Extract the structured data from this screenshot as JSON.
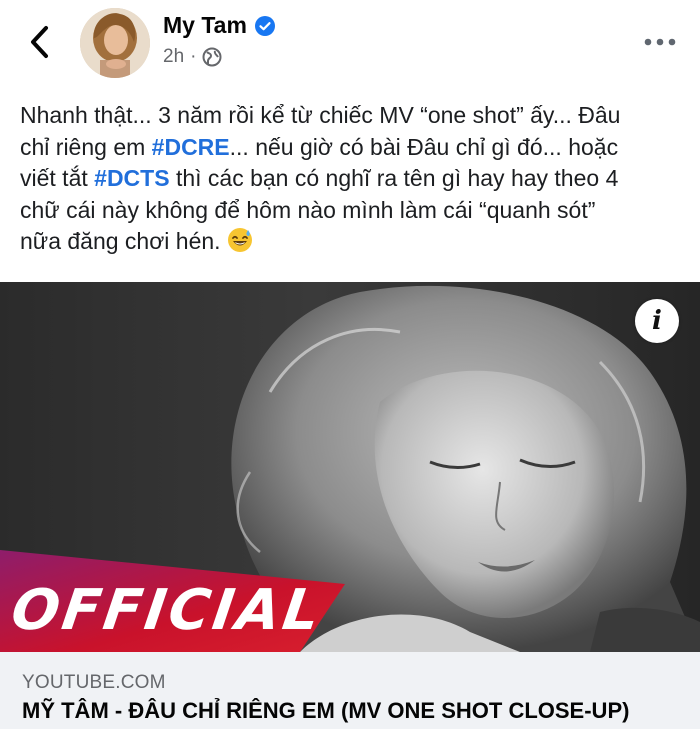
{
  "header": {
    "author_name": "My Tam",
    "time": "2h",
    "audience": "·"
  },
  "post": {
    "line1": "Nhanh thật... 3 năm rồi kể từ chiếc MV “one shot” ấy... Đâu",
    "line2_pre": "chỉ riêng em ",
    "line2_tag": "#DCRE",
    "line2_post": "... nếu giờ có bài Đâu chỉ gì đó... hoặc",
    "line3_pre": "viết tắt ",
    "line3_tag": "#DCTS",
    "line3_post": " thì các bạn có nghĩ ra tên gì hay hay theo 4",
    "line4": "chữ cái này không để hôm nào mình làm cái “quanh sót”",
    "line5": "nữa đăng chơi hén. "
  },
  "video": {
    "badge_text": "OFFICIAL",
    "info_label": "i"
  },
  "link": {
    "domain": "YOUTUBE.COM",
    "title": "MỸ TÂM - ĐÂU CHỈ RIÊNG EM (MV ONE SHOT CLOSE-UP)"
  },
  "colors": {
    "hashtag": "#216fdb",
    "verified": "#1877f2",
    "badge_red": "#c9122b",
    "badge_magenta": "#8e1d6b"
  }
}
